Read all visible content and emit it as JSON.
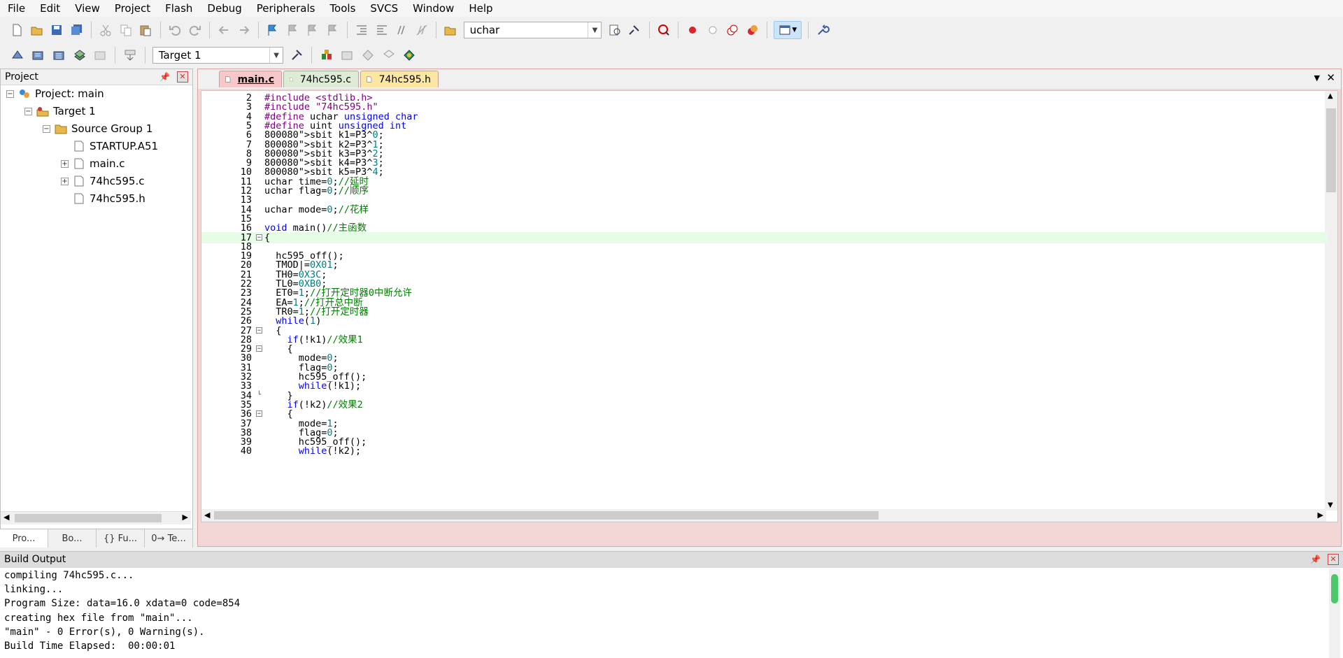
{
  "menu": [
    "File",
    "Edit",
    "View",
    "Project",
    "Flash",
    "Debug",
    "Peripherals",
    "Tools",
    "SVCS",
    "Window",
    "Help"
  ],
  "toolbar": {
    "find_combo": "uchar",
    "target_combo": "Target 1"
  },
  "project_panel": {
    "title": "Project",
    "tree": [
      {
        "label": "Project: main",
        "level": 0,
        "expander": "−"
      },
      {
        "label": "Target 1",
        "level": 1,
        "expander": "−"
      },
      {
        "label": "Source Group 1",
        "level": 2,
        "expander": "−"
      },
      {
        "label": "STARTUP.A51",
        "level": 3,
        "expander": ""
      },
      {
        "label": "main.c",
        "level": 3,
        "expander": "+"
      },
      {
        "label": "74hc595.c",
        "level": 3,
        "expander": "+"
      },
      {
        "label": "74hc595.h",
        "level": 3,
        "expander": ""
      }
    ],
    "bottom_tabs": [
      "Pro...",
      "Bo...",
      "{} Fu...",
      "0→ Te..."
    ]
  },
  "editor": {
    "tabs": [
      "main.c",
      "74hc595.c",
      "74hc595.h"
    ],
    "lines": [
      {
        "n": "2",
        "text": "#include <stdlib.h>"
      },
      {
        "n": "3",
        "text": "#include \"74hc595.h\""
      },
      {
        "n": "4",
        "text": "#define uchar unsigned char"
      },
      {
        "n": "5",
        "text": "#define uint unsigned int"
      },
      {
        "n": "6",
        "text": "sbit k1=P3^0;"
      },
      {
        "n": "7",
        "text": "sbit k2=P3^1;"
      },
      {
        "n": "8",
        "text": "sbit k3=P3^2;"
      },
      {
        "n": "9",
        "text": "sbit k4=P3^3;"
      },
      {
        "n": "10",
        "text": "sbit k5=P3^4;"
      },
      {
        "n": "11",
        "text": "uchar time=0;//延时"
      },
      {
        "n": "12",
        "text": "uchar flag=0;//顺序"
      },
      {
        "n": "13",
        "text": ""
      },
      {
        "n": "14",
        "text": "uchar mode=0;//花样"
      },
      {
        "n": "15",
        "text": ""
      },
      {
        "n": "16",
        "text": "void main()//主函数"
      },
      {
        "n": "17",
        "text": "{"
      },
      {
        "n": "18",
        "text": ""
      },
      {
        "n": "19",
        "text": "  hc595_off();"
      },
      {
        "n": "20",
        "text": "  TMOD|=0X01;"
      },
      {
        "n": "21",
        "text": "  TH0=0X3C;"
      },
      {
        "n": "22",
        "text": "  TL0=0XB0;"
      },
      {
        "n": "23",
        "text": "  ET0=1;//打开定时器0中断允许"
      },
      {
        "n": "24",
        "text": "  EA=1;//打开总中断"
      },
      {
        "n": "25",
        "text": "  TR0=1;//打开定时器"
      },
      {
        "n": "26",
        "text": "  while(1)"
      },
      {
        "n": "27",
        "text": "  {"
      },
      {
        "n": "28",
        "text": "    if(!k1)//效果1"
      },
      {
        "n": "29",
        "text": "    {"
      },
      {
        "n": "30",
        "text": "      mode=0;"
      },
      {
        "n": "31",
        "text": "      flag=0;"
      },
      {
        "n": "32",
        "text": "      hc595_off();"
      },
      {
        "n": "33",
        "text": "      while(!k1);"
      },
      {
        "n": "34",
        "text": "    }"
      },
      {
        "n": "35",
        "text": "    if(!k2)//效果2"
      },
      {
        "n": "36",
        "text": "    {"
      },
      {
        "n": "37",
        "text": "      mode=1;"
      },
      {
        "n": "38",
        "text": "      flag=0;"
      },
      {
        "n": "39",
        "text": "      hc595_off();"
      },
      {
        "n": "40",
        "text": "      while(!k2);"
      }
    ]
  },
  "build_output": {
    "title": "Build Output",
    "lines": [
      "compiling 74hc595.c...",
      "linking...",
      "Program Size: data=16.0 xdata=0 code=854",
      "creating hex file from \"main\"...",
      "\"main\" - 0 Error(s), 0 Warning(s).",
      "Build Time Elapsed:  00:00:01"
    ]
  },
  "colors": {
    "keyword": "#0000ff",
    "preprocessor": "#800080",
    "string": "#a31515",
    "number": "#008080",
    "comment": "#008000"
  }
}
